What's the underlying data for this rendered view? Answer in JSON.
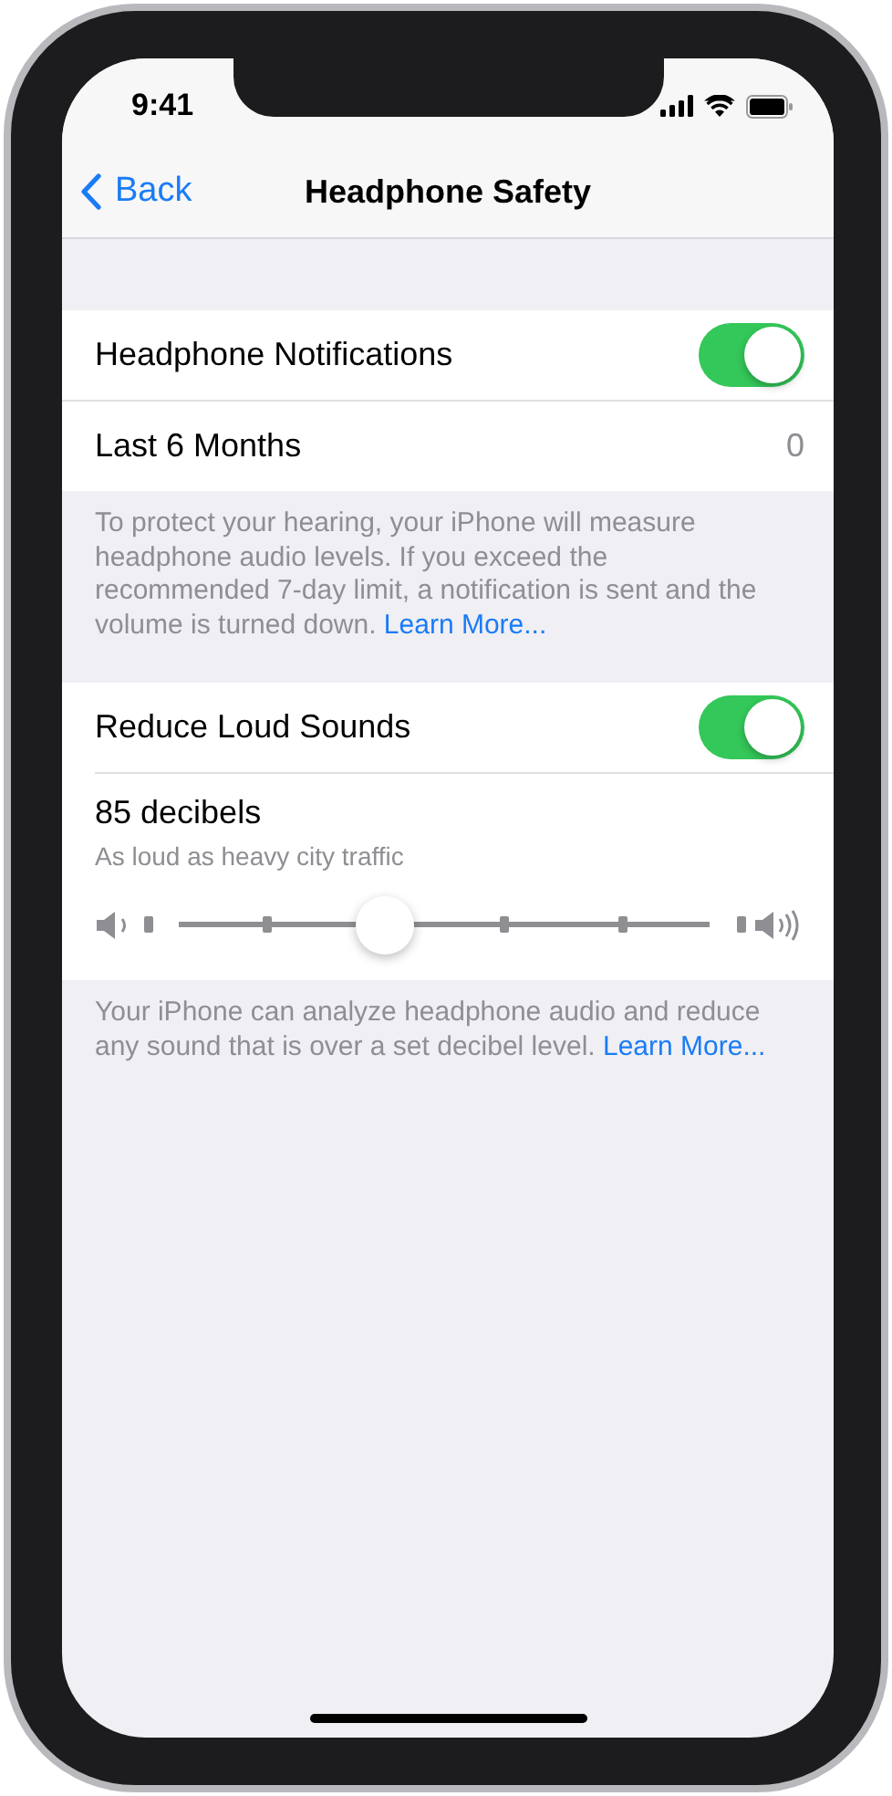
{
  "status_bar": {
    "time": "9:41"
  },
  "nav": {
    "back": "Back",
    "title": "Headphone Safety"
  },
  "notifications": [
    {
      "kind": "toggle",
      "label": "Headphone Notifications",
      "on": true
    },
    {
      "kind": "value",
      "label": "Last 6 Months",
      "value": "0"
    }
  ],
  "notifications_footer": {
    "text": "To protect your hearing, your iPhone will measure headphone audio levels. If you exceed the recommended 7-day limit, a notification is sent and the volume is turned down.",
    "link": "Learn More..."
  },
  "reduce": {
    "label": "Reduce Loud Sounds",
    "on": true,
    "level_title": "85 decibels",
    "level_subtitle": "As loud as heavy city traffic",
    "slider": {
      "level": 0.4
    }
  },
  "reduce_footer": {
    "text": "Your iPhone can analyze headphone audio and reduce any sound that is over a set decibel level.",
    "link": "Learn More..."
  }
}
